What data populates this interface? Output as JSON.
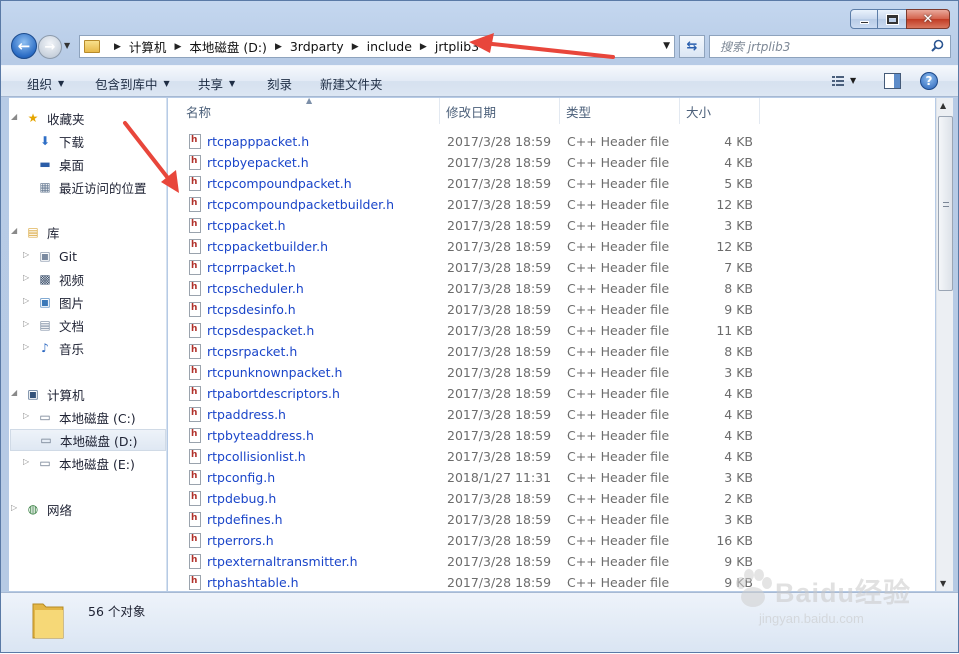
{
  "window": {
    "controls": [
      "minimize",
      "maximize",
      "close"
    ],
    "close_glyph": "✕"
  },
  "navigation": {
    "breadcrumb": [
      "计算机",
      "本地磁盘 (D:)",
      "3rdparty",
      "include",
      "jrtplib3"
    ],
    "search_placeholder": "搜索 jrtplib3"
  },
  "toolbar": {
    "organize": "组织",
    "include_in_library": "包含到库中",
    "share": "共享",
    "burn": "刻录",
    "new_folder": "新建文件夹",
    "help": "?"
  },
  "sidebar": {
    "favorites": "收藏夹",
    "downloads": "下载",
    "desktop": "桌面",
    "recent": "最近访问的位置",
    "libraries": "库",
    "git": "Git",
    "videos": "视频",
    "pictures": "图片",
    "documents": "文档",
    "music": "音乐",
    "computer": "计算机",
    "drive_c": "本地磁盘 (C:)",
    "drive_d": "本地磁盘 (D:)",
    "drive_e": "本地磁盘 (E:)",
    "network": "网络"
  },
  "columns": {
    "name": "名称",
    "date": "修改日期",
    "type": "类型",
    "size": "大小"
  },
  "files": [
    {
      "name": "rtcpapppacket.h",
      "date": "2017/3/28 18:59",
      "type": "C++ Header file",
      "size": "4 KB"
    },
    {
      "name": "rtcpbyepacket.h",
      "date": "2017/3/28 18:59",
      "type": "C++ Header file",
      "size": "4 KB"
    },
    {
      "name": "rtcpcompoundpacket.h",
      "date": "2017/3/28 18:59",
      "type": "C++ Header file",
      "size": "5 KB"
    },
    {
      "name": "rtcpcompoundpacketbuilder.h",
      "date": "2017/3/28 18:59",
      "type": "C++ Header file",
      "size": "12 KB"
    },
    {
      "name": "rtcppacket.h",
      "date": "2017/3/28 18:59",
      "type": "C++ Header file",
      "size": "3 KB"
    },
    {
      "name": "rtcppacketbuilder.h",
      "date": "2017/3/28 18:59",
      "type": "C++ Header file",
      "size": "12 KB"
    },
    {
      "name": "rtcprrpacket.h",
      "date": "2017/3/28 18:59",
      "type": "C++ Header file",
      "size": "7 KB"
    },
    {
      "name": "rtcpscheduler.h",
      "date": "2017/3/28 18:59",
      "type": "C++ Header file",
      "size": "8 KB"
    },
    {
      "name": "rtcpsdesinfo.h",
      "date": "2017/3/28 18:59",
      "type": "C++ Header file",
      "size": "9 KB"
    },
    {
      "name": "rtcpsdespacket.h",
      "date": "2017/3/28 18:59",
      "type": "C++ Header file",
      "size": "11 KB"
    },
    {
      "name": "rtcpsrpacket.h",
      "date": "2017/3/28 18:59",
      "type": "C++ Header file",
      "size": "8 KB"
    },
    {
      "name": "rtcpunknownpacket.h",
      "date": "2017/3/28 18:59",
      "type": "C++ Header file",
      "size": "3 KB"
    },
    {
      "name": "rtpabortdescriptors.h",
      "date": "2017/3/28 18:59",
      "type": "C++ Header file",
      "size": "4 KB"
    },
    {
      "name": "rtpaddress.h",
      "date": "2017/3/28 18:59",
      "type": "C++ Header file",
      "size": "4 KB"
    },
    {
      "name": "rtpbyteaddress.h",
      "date": "2017/3/28 18:59",
      "type": "C++ Header file",
      "size": "4 KB"
    },
    {
      "name": "rtpcollisionlist.h",
      "date": "2017/3/28 18:59",
      "type": "C++ Header file",
      "size": "4 KB"
    },
    {
      "name": "rtpconfig.h",
      "date": "2018/1/27 11:31",
      "type": "C++ Header file",
      "size": "3 KB"
    },
    {
      "name": "rtpdebug.h",
      "date": "2017/3/28 18:59",
      "type": "C++ Header file",
      "size": "2 KB"
    },
    {
      "name": "rtpdefines.h",
      "date": "2017/3/28 18:59",
      "type": "C++ Header file",
      "size": "3 KB"
    },
    {
      "name": "rtperrors.h",
      "date": "2017/3/28 18:59",
      "type": "C++ Header file",
      "size": "16 KB"
    },
    {
      "name": "rtpexternaltransmitter.h",
      "date": "2017/3/28 18:59",
      "type": "C++ Header file",
      "size": "9 KB"
    },
    {
      "name": "rtphashtable.h",
      "date": "2017/3/28 18:59",
      "type": "C++ Header file",
      "size": "9 KB"
    }
  ],
  "status": {
    "item_count": "56 个对象"
  },
  "watermark": {
    "brand": "Baidu经验",
    "url": "jingyan.baidu.com"
  },
  "colors": {
    "link": "#1a45c9",
    "annotation_arrow": "#e8463b",
    "frame": "#b9cde7"
  }
}
